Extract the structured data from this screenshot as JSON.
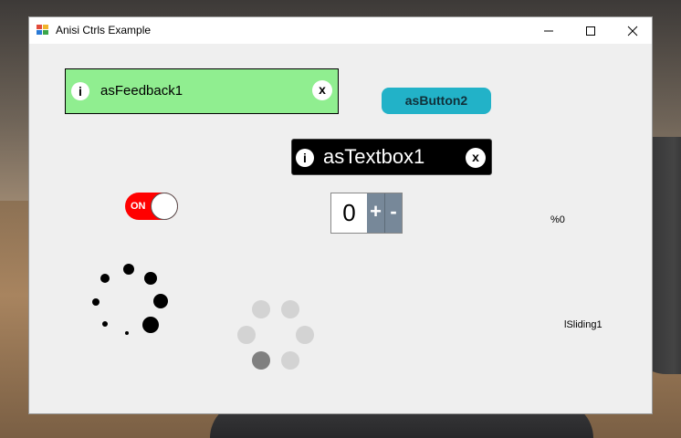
{
  "window": {
    "title": "Anisi Ctrls Example",
    "minimize_icon": "minimize-icon",
    "maximize_icon": "maximize-icon",
    "close_icon": "close-icon"
  },
  "feedback": {
    "label": "asFeedback1",
    "info_glyph": "i",
    "close_glyph": "x",
    "background": "#90ee90"
  },
  "button": {
    "label": "asButton2",
    "color": "#22b2c8"
  },
  "textbox": {
    "value": "asTextbox1",
    "info_glyph": "i",
    "close_glyph": "x",
    "background": "#000000"
  },
  "toggle": {
    "state_label": "ON",
    "color": "#ff0000"
  },
  "stepper": {
    "value": "0",
    "plus_label": "+",
    "minus_label": "-",
    "button_color": "#778899"
  },
  "progress": {
    "label": "%0"
  },
  "sliding": {
    "label": "lSliding1"
  },
  "spinners": {
    "black_color": "#000000",
    "gray_color": "#d3d3d3",
    "gray_active_color": "#808080"
  }
}
